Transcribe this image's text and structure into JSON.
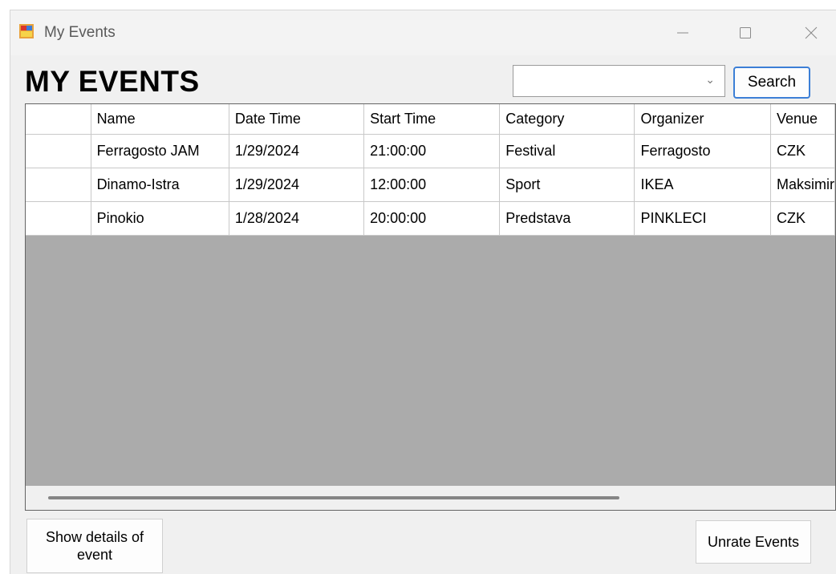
{
  "window": {
    "title": "My Events"
  },
  "header": {
    "title": "MY EVENTS"
  },
  "search": {
    "combo_value": "",
    "button_label": "Search"
  },
  "table": {
    "columns": [
      "Name",
      "Date Time",
      "Start Time",
      "Category",
      "Organizer",
      "Venue"
    ],
    "rows": [
      [
        "Ferragosto JAM",
        "1/29/2024",
        "21:00:00",
        "Festival",
        "Ferragosto",
        "CZK"
      ],
      [
        "Dinamo-Istra",
        "1/29/2024",
        "12:00:00",
        "Sport",
        "IKEA",
        "Maksimir"
      ],
      [
        "Pinokio",
        "1/28/2024",
        "20:00:00",
        "Predstava",
        "PINKLECI",
        "CZK"
      ]
    ]
  },
  "actions": {
    "details_label": "Show details of event",
    "unrate_label": "Unrate Events"
  },
  "colors": {
    "accent": "#3c7fd6",
    "grid_background": "#ababab"
  },
  "icons": {
    "app": "app-window-icon",
    "minimize": "minimize-icon",
    "maximize": "maximize-icon",
    "close": "close-icon",
    "dropdown": "chevron-down-icon"
  }
}
